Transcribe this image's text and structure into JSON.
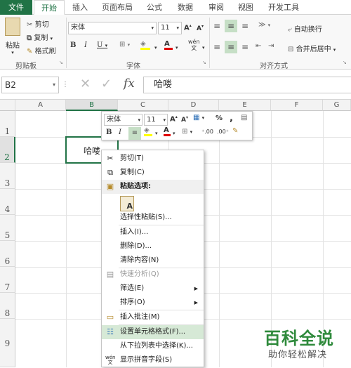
{
  "tabs": {
    "file": "文件",
    "home": "开始",
    "insert": "插入",
    "page_layout": "页面布局",
    "formulas": "公式",
    "data": "数据",
    "review": "审阅",
    "view": "视图",
    "developer": "开发工具"
  },
  "ribbon": {
    "paste": "粘贴",
    "cut": "剪切",
    "copy": "复制",
    "format_painter": "格式刷",
    "clipboard_label": "剪贴板",
    "font_name": "宋体",
    "font_size": "11",
    "font_label": "字体",
    "wrap_text": "自动换行",
    "merge_center": "合并后居中",
    "alignment_label": "对齐方式"
  },
  "formula_bar": {
    "name_box": "B2",
    "fx": "fx",
    "value": "哈喽"
  },
  "columns": [
    "A",
    "B",
    "C",
    "D",
    "E",
    "F",
    "G"
  ],
  "rows": [
    "1",
    "2",
    "3",
    "4",
    "5",
    "6",
    "7",
    "8",
    "9"
  ],
  "cell_b2": "哈喽",
  "mini_toolbar": {
    "font_name": "宋体",
    "font_size": "11",
    "percent": "%",
    "comma": ","
  },
  "context_menu": {
    "cut": "剪切(T)",
    "copy": "复制(C)",
    "paste_options": "粘贴选项:",
    "paste_special": "选择性粘贴(S)...",
    "insert": "插入(I)...",
    "delete": "删除(D)...",
    "clear": "清除内容(N)",
    "quick_analysis": "快速分析(Q)",
    "filter": "筛选(E)",
    "sort": "排序(O)",
    "insert_comment": "插入批注(M)",
    "format_cells": "设置单元格格式(F)...",
    "pick_list": "从下拉列表中选择(K)...",
    "phonetic": "显示拼音字段(S)"
  },
  "watermark": {
    "title": "百科全说",
    "subtitle": "助你轻松解决"
  },
  "colors": {
    "excel_green": "#217346",
    "highlight_green": "#d6e9d6",
    "font_red": "#e00000",
    "fill_yellow": "#ffff00"
  }
}
